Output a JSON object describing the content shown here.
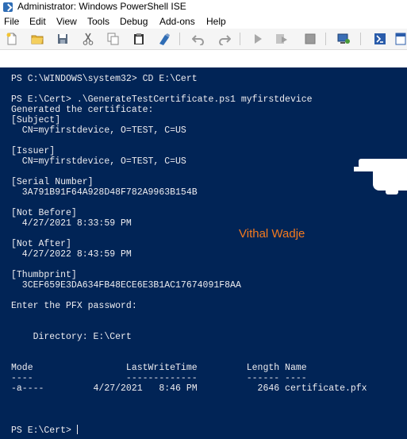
{
  "window": {
    "title": "Administrator: Windows PowerShell ISE"
  },
  "menubar": {
    "items": [
      "File",
      "Edit",
      "View",
      "Tools",
      "Debug",
      "Add-ons",
      "Help"
    ]
  },
  "toolbar": {
    "icons": [
      "new-file-icon",
      "open-folder-icon",
      "save-icon",
      "cut-icon",
      "copy-icon",
      "paste-icon",
      "clear-console-icon",
      "undo-icon",
      "redo-icon",
      "run-script-icon",
      "run-selection-icon",
      "stop-icon",
      "debug-icon",
      "remote-powershell-icon",
      "start-powershell-icon",
      "show-script-pane-icon"
    ]
  },
  "console": {
    "background": "#012456",
    "foreground": "#eeedf0",
    "lines": [
      "PS C:\\WINDOWS\\system32> CD E:\\Cert",
      "",
      "PS E:\\Cert> .\\GenerateTestCertificate.ps1 myfirstdevice",
      "Generated the certificate:",
      "[Subject]",
      "  CN=myfirstdevice, O=TEST, C=US",
      "",
      "[Issuer]",
      "  CN=myfirstdevice, O=TEST, C=US",
      "",
      "[Serial Number]",
      "  3A791B91F64A928D48F782A9963B154B",
      "",
      "[Not Before]",
      "  4/27/2021 8:33:59 PM",
      "",
      "[Not After]",
      "  4/27/2022 8:43:59 PM",
      "",
      "[Thumbprint]",
      "  3CEF659E3DA634FB48ECE6E3B1AC17674091F8AA",
      "",
      "Enter the PFX password:",
      "",
      "",
      "    Directory: E:\\Cert",
      "",
      "",
      "Mode                 LastWriteTime         Length Name",
      "----                 -------------         ------ ----",
      "-a----         4/27/2021   8:46 PM           2646 certificate.pfx",
      "",
      "",
      "",
      "PS E:\\Cert> "
    ]
  },
  "watermark": {
    "text": "Vithal Wadje",
    "color": "#f57a1e"
  }
}
